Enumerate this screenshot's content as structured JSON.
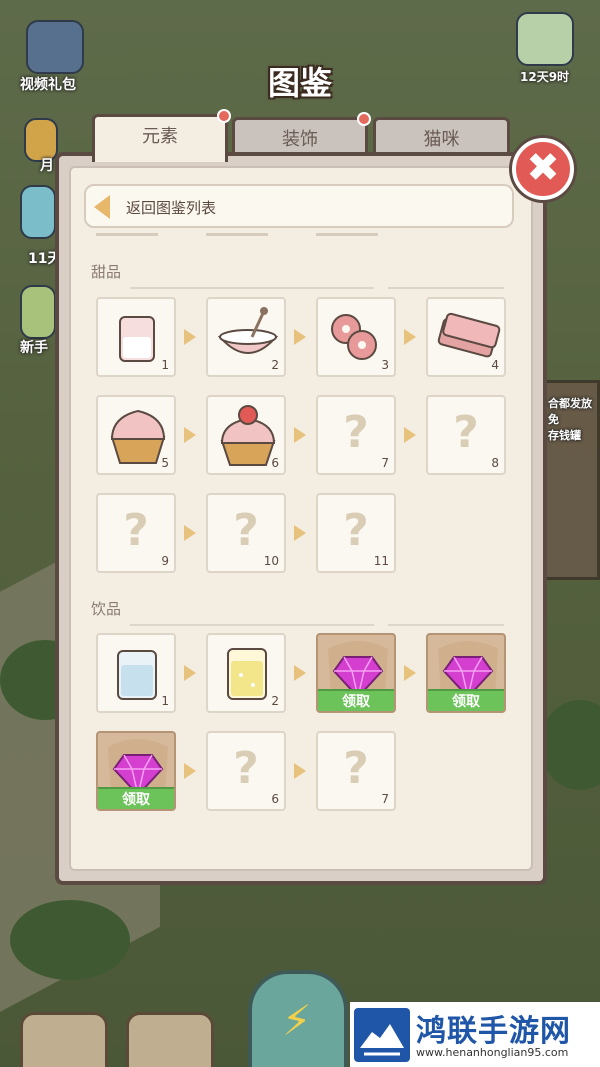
{
  "title": "图鉴",
  "tabs": [
    {
      "label": "元素",
      "active": true,
      "badge": true
    },
    {
      "label": "装饰",
      "active": false,
      "badge": true
    },
    {
      "label": "猫咪",
      "active": false,
      "badge": false
    }
  ],
  "back_label": "返回图鉴列表",
  "background_labels": {
    "video_gift": "视频礼包",
    "days": "12天9时",
    "newbie": "新手",
    "eleven": "11天",
    "month": "月",
    "sign": "合都发放免\n存钱罐"
  },
  "sections": [
    {
      "label": "甜品",
      "items": [
        {
          "num": "1",
          "icon": "milk-glass-icon",
          "state": "unlocked"
        },
        {
          "num": "2",
          "icon": "mixing-bowl-icon",
          "state": "unlocked"
        },
        {
          "num": "3",
          "icon": "donuts-icon",
          "state": "unlocked"
        },
        {
          "num": "4",
          "icon": "biscuit-icon",
          "state": "unlocked"
        },
        {
          "num": "5",
          "icon": "cupcake-icon",
          "state": "unlocked"
        },
        {
          "num": "6",
          "icon": "strawberry-cupcake-icon",
          "state": "unlocked"
        },
        {
          "num": "7",
          "icon": "question-mark-icon",
          "state": "locked"
        },
        {
          "num": "8",
          "icon": "question-mark-icon",
          "state": "locked"
        },
        {
          "num": "9",
          "icon": "question-mark-icon",
          "state": "locked"
        },
        {
          "num": "10",
          "icon": "question-mark-icon",
          "state": "locked"
        },
        {
          "num": "11",
          "icon": "question-mark-icon",
          "state": "locked"
        }
      ]
    },
    {
      "label": "饮品",
      "items": [
        {
          "num": "1",
          "icon": "water-glass-icon",
          "state": "unlocked"
        },
        {
          "num": "2",
          "icon": "lemonade-icon",
          "state": "unlocked"
        },
        {
          "num": "",
          "icon": "gem-icon",
          "state": "claim",
          "claim_label": "领取"
        },
        {
          "num": "",
          "icon": "gem-icon",
          "state": "claim",
          "claim_label": "领取"
        },
        {
          "num": "",
          "icon": "gem-icon",
          "state": "claim",
          "claim_label": "领取"
        },
        {
          "num": "6",
          "icon": "question-mark-icon",
          "state": "locked"
        },
        {
          "num": "7",
          "icon": "question-mark-icon",
          "state": "locked"
        }
      ]
    }
  ],
  "question_glyph": "?",
  "close_glyph": "✖",
  "watermark": {
    "title": "鸿联手游网",
    "url": "www.henanhonglian95.com"
  },
  "colors": {
    "claim_green": "#6cc35a",
    "close_red": "#e25a55",
    "gem_pink": "#d43fd0"
  }
}
